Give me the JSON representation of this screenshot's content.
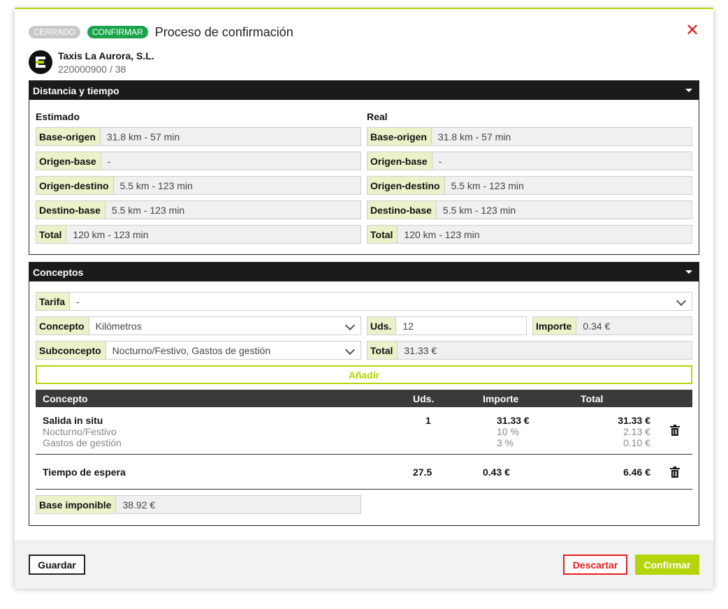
{
  "header": {
    "badge_closed": "CERRADO",
    "badge_confirm": "CONFIRMAR",
    "title": "Proceso de confirmación",
    "close_icon": "close-x-icon",
    "colors": {
      "accent": "#b5d40a",
      "confirm_badge": "#1aa34a",
      "danger": "#e21e1e"
    }
  },
  "company": {
    "name": "Taxis La Aurora, S.L.",
    "code": "220000900 / 38"
  },
  "distance": {
    "title": "Distancia y tiempo",
    "estimated": {
      "title": "Estimado",
      "rows": [
        {
          "label": "Base-origen",
          "value": "31.8 km - 57 min"
        },
        {
          "label": "Origen-base",
          "value": "-"
        },
        {
          "label": "Origen-destino",
          "value": "5.5 km - 123 min"
        },
        {
          "label": "Destino-base",
          "value": "5.5 km - 123 min"
        },
        {
          "label": "Total",
          "value": "120 km - 123 min"
        }
      ]
    },
    "real": {
      "title": "Real",
      "rows": [
        {
          "label": "Base-origen",
          "value": "31.8 km - 57 min"
        },
        {
          "label": "Origen-base",
          "value": "-"
        },
        {
          "label": "Origen-destino",
          "value": "5.5 km - 123 min"
        },
        {
          "label": "Destino-base",
          "value": "5.5 km - 123 min"
        },
        {
          "label": "Total",
          "value": "120 km - 123 min"
        }
      ]
    }
  },
  "concepts": {
    "title": "Conceptos",
    "tarifa": {
      "label": "Tarifa",
      "value": "-"
    },
    "concepto": {
      "label": "Concepto",
      "value": "Kilómetros"
    },
    "uds": {
      "label": "Uds.",
      "value": "12"
    },
    "importe": {
      "label": "Importe",
      "value": "0.34 €"
    },
    "subconcepto": {
      "label": "Subconcepto",
      "value": "Nocturno/Festivo, Gastos de gestión"
    },
    "total": {
      "label": "Total",
      "value": "31.33 €"
    },
    "add_label": "Añadir",
    "table": {
      "headers": [
        "Concepto",
        "Uds.",
        "Importe",
        "Total"
      ],
      "rows": [
        {
          "concept": "Salida in situ",
          "uds": "1",
          "importe": "31.33 €",
          "total": "31.33 €",
          "subs": [
            {
              "name": "Nocturno/Festivo",
              "importe": "10 %",
              "total": "2.13 €"
            },
            {
              "name": "Gastos de gestión",
              "importe": "3 %",
              "total": "0.10 €"
            }
          ]
        },
        {
          "concept": "Tiempo de espera",
          "uds": "27.5",
          "importe": "0.43 €",
          "total": "6.46 €"
        }
      ]
    },
    "base": {
      "label": "Base imponible",
      "value": "38.92 €"
    }
  },
  "footer": {
    "save": "Guardar",
    "discard": "Descartar",
    "confirm": "Confirmar"
  }
}
